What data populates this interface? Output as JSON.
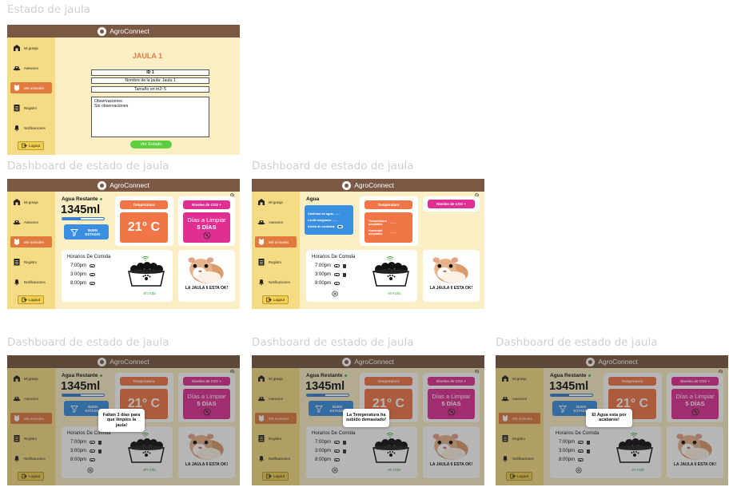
{
  "app_title": "AgroConnect",
  "nav": [
    "Mi granja",
    "Asesores",
    "Mis animales",
    "Registro",
    "Notificaciones"
  ],
  "logout": "Logout",
  "frames": [
    {
      "label": "Estado de jaula"
    },
    {
      "label": "Dashboard de estado de jaula"
    },
    {
      "label": "Dashboard de estado de jaula"
    },
    {
      "label": "Dashboard de estado de jaula"
    },
    {
      "label": "Dashboard de estado de jaula"
    },
    {
      "label": "Dashboard de estado de jaula"
    }
  ],
  "estado": {
    "title": "JAULA 1",
    "id_label": "ID 1",
    "name_field": "Nombre de la jaula: Jaula 1",
    "size_field": "Tamaño en m2: 5",
    "obs_title": "Observaciones:",
    "obs_text": "Sin observaciones",
    "button": "Ver Estado"
  },
  "dash": {
    "water_title": "Agua Restante",
    "water_value": "1345ml",
    "water_level_pct": 45,
    "filter_label": "BUEN ESTADO!",
    "temp_label": "Temperatura",
    "temp_value": "21° C",
    "co2_label": "Niveles de CO2 +",
    "clean_title": "Días a Limpiar",
    "clean_value": "5 DÍAS",
    "schedule_title": "Horarios De Comida",
    "times": [
      "7:00pm",
      "3:00pm",
      "8:00pm"
    ],
    "route": "en ruta",
    "status": "LA JAULA 6 ESTA OK!"
  },
  "dash2": {
    "water_title": "Agua",
    "water_lines": [
      "Cantidad de agua: ......",
      "Límite asignado: ......",
      "Alerta de cantidad:"
    ],
    "temp_lines": [
      "Temperatura aceptable",
      "Humedad aceptable"
    ],
    "temp_dots": [
      ".......",
      "......."
    ]
  },
  "popups": [
    "Faltan 3 días para que limpies la jaula!",
    "La Temperatura ha subido demasiado!",
    "El Agua esta por acabarse!"
  ]
}
